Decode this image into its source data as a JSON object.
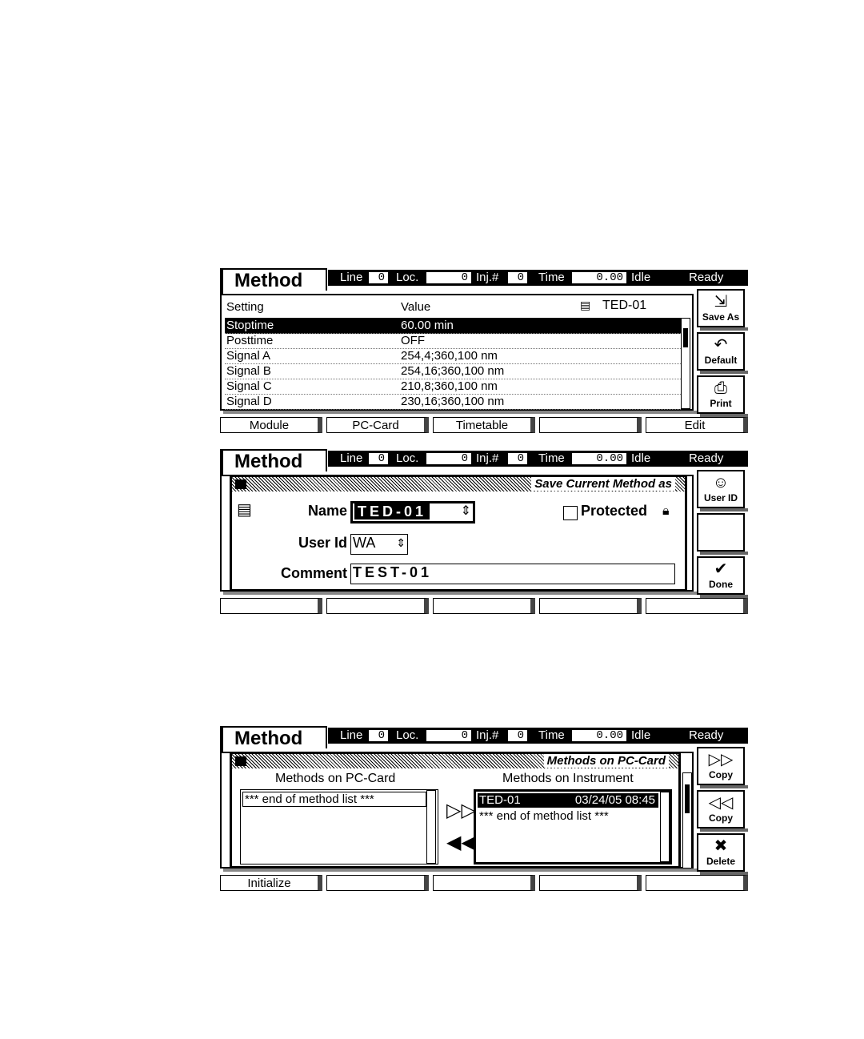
{
  "header": {
    "title": "Method",
    "line_label": "Line",
    "line_value": "0",
    "loc_label": "Loc.",
    "loc_value": "0",
    "inj_label": "Inj.#",
    "inj_value": "0",
    "time_label": "Time",
    "time_value": "0.00",
    "idle_label": "Idle",
    "status": "Ready"
  },
  "screen1": {
    "col_setting": "Setting",
    "col_value": "Value",
    "method_name": "TED-01",
    "rows": [
      {
        "setting": "Stoptime",
        "value": "60.00 min"
      },
      {
        "setting": "Posttime",
        "value": "OFF"
      },
      {
        "setting": "Signal A",
        "value": "254,4;360,100 nm"
      },
      {
        "setting": "Signal B",
        "value": "254,16;360,100 nm"
      },
      {
        "setting": "Signal C",
        "value": "210,8;360,100 nm"
      },
      {
        "setting": "Signal D",
        "value": "230,16;360,100 nm"
      }
    ],
    "side_buttons": [
      "Save As",
      "Default",
      "Print"
    ],
    "fkeys": [
      "Module",
      "PC-Card",
      "Timetable",
      "",
      "Edit"
    ]
  },
  "screen2": {
    "dialog_title": "Save Current Method as",
    "name_label": "Name",
    "name_value": "TED-01",
    "protected_label": "Protected",
    "userid_label": "User Id",
    "userid_value": "WA",
    "comment_label": "Comment",
    "comment_value": "TEST-01",
    "side_buttons": [
      "User ID",
      "",
      "Done"
    ]
  },
  "screen3": {
    "dialog_title": "Methods on PC-Card",
    "left_header": "Methods on PC-Card",
    "right_header": "Methods on Instrument",
    "left_items": [
      "*** end of method list ***"
    ],
    "right_items": [
      {
        "name": "TED-01",
        "date": "03/24/05 08:45"
      },
      {
        "name": "*** end of method list ***",
        "date": ""
      }
    ],
    "side_buttons": [
      "Copy",
      "Copy",
      "Delete"
    ],
    "fkeys": [
      "Initialize",
      "",
      "",
      "",
      ""
    ]
  },
  "icons": [
    "save-as-icon",
    "undo-icon",
    "printer-icon",
    "user-id-icon",
    "checkmark-icon",
    "lock-icon",
    "copy-right-icon",
    "copy-left-icon",
    "delete-icon",
    "method-icon"
  ]
}
